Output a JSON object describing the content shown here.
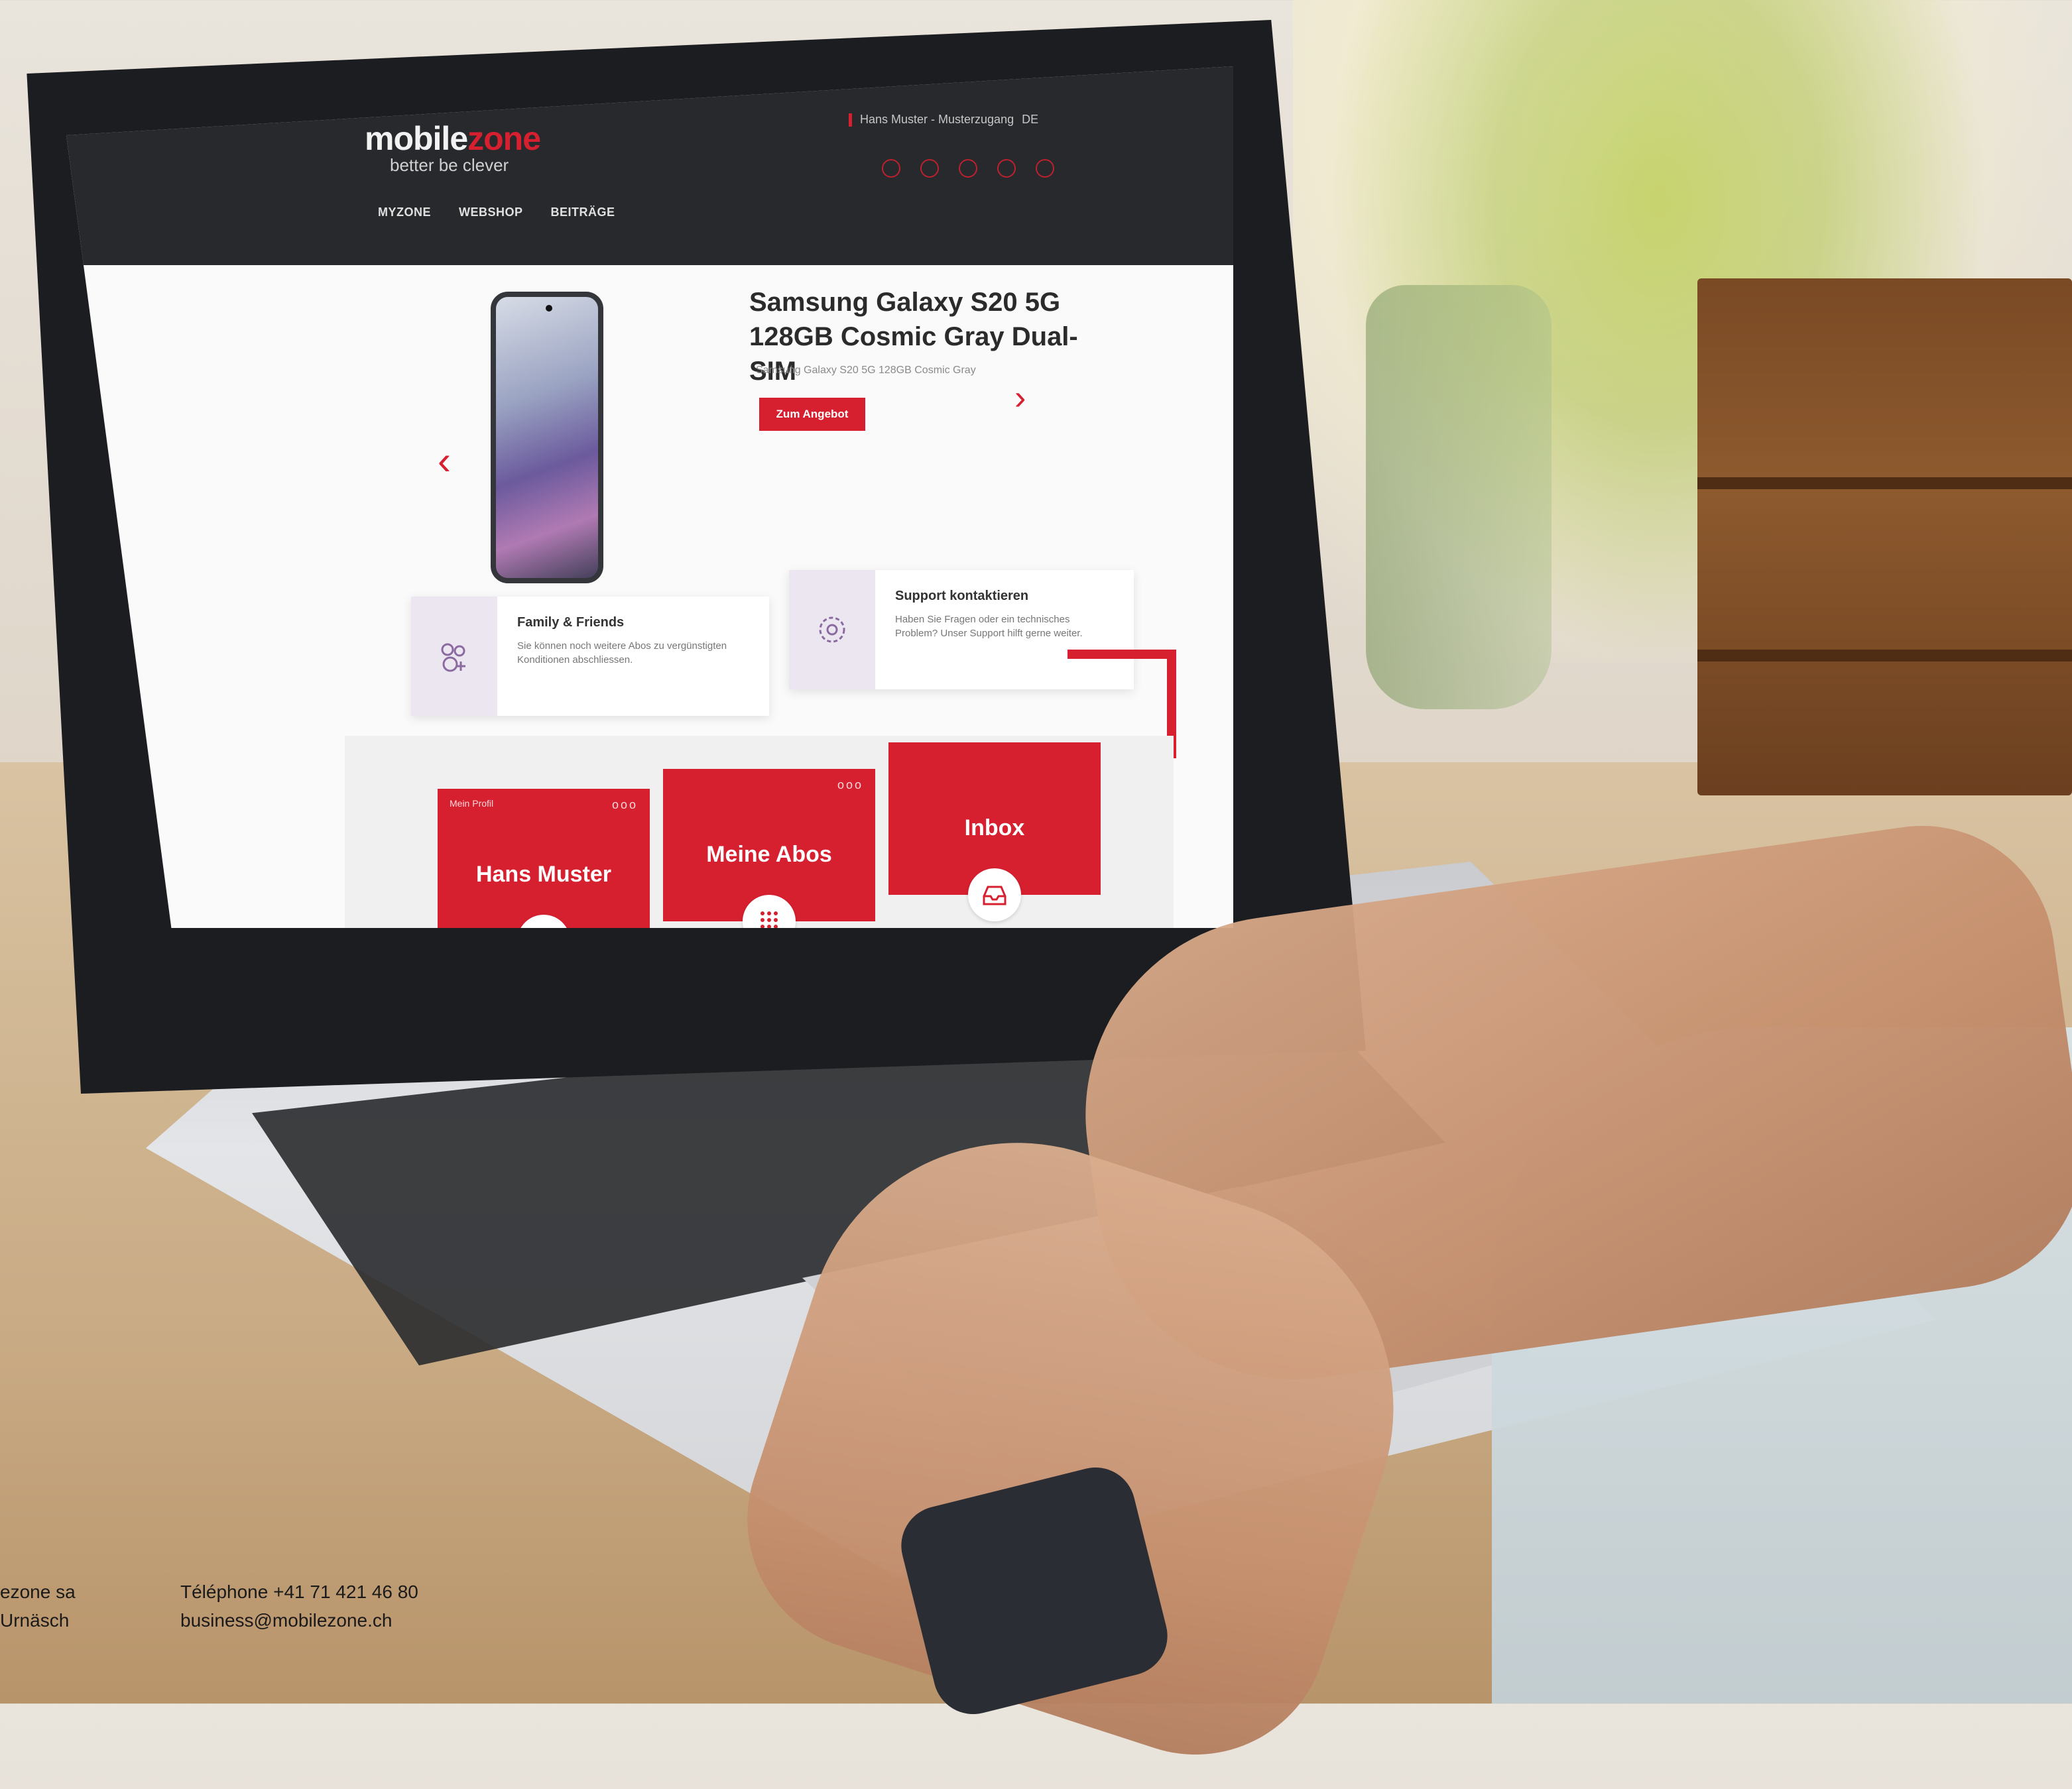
{
  "site": {
    "logo": {
      "word_main": "mobile",
      "word_accent": "zone",
      "tagline": "better be clever"
    },
    "user_bar": {
      "user_text": "Hans Muster - Musterzugang",
      "lang": "DE"
    },
    "nav": [
      "MYZONE",
      "WEBSHOP",
      "BEITRÄGE"
    ],
    "hero": {
      "title": "Samsung Galaxy S20 5G 128GB Cosmic Gray Dual-SIM",
      "subtitle": "Samsung Galaxy S20 5G 128GB Cosmic Gray",
      "cta": "Zum Angebot",
      "prev": "‹",
      "next": "›"
    },
    "cards": {
      "family": {
        "title": "Family & Friends",
        "text": "Sie können noch weitere Abos zu vergünstigten Konditionen abschliessen."
      },
      "support": {
        "title": "Support kontaktieren",
        "text": "Haben Sie Fragen oder ein technisches Problem? Unser Support hilft gerne weiter."
      }
    },
    "tiles": {
      "profile": {
        "label": "Mein Profil",
        "title": "Hans Muster",
        "dots": "ooo"
      },
      "abos": {
        "title": "Meine Abos",
        "dots": "ooo"
      },
      "inbox": {
        "title": "Inbox"
      }
    }
  },
  "footer": {
    "company_line1": "ezone sa",
    "company_line2": "Urnäsch",
    "phone": "Téléphone +41 71 421 46 80",
    "email": "business@mobilezone.ch"
  },
  "colors": {
    "brand_red": "#d7202f",
    "header_dark": "#27292d"
  }
}
